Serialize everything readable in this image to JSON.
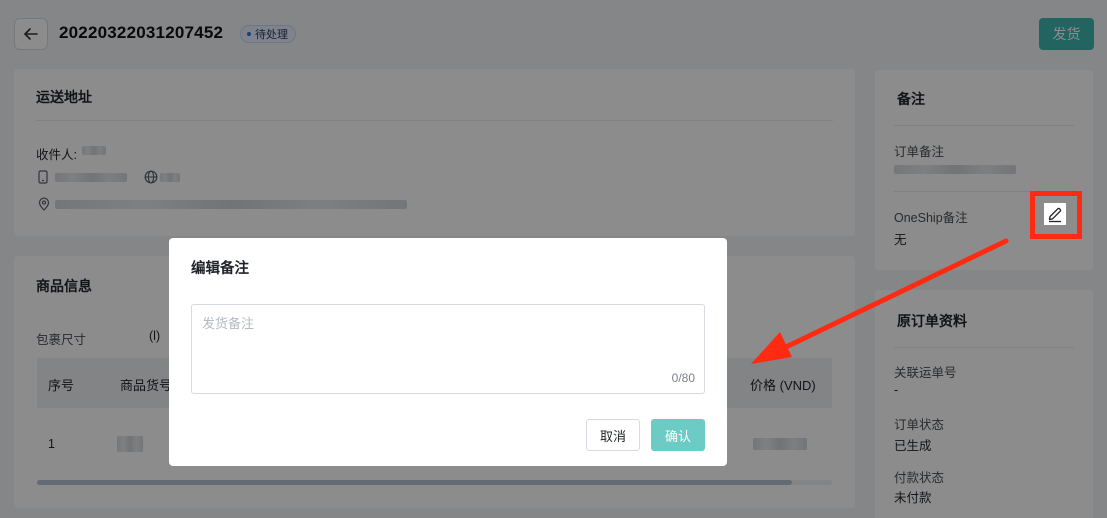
{
  "header": {
    "order_id": "20220322031207452",
    "status": "待处理",
    "ship_button": "发货"
  },
  "shipping_address": {
    "title": "运送地址",
    "recipient_label": "收件人:"
  },
  "product_info": {
    "title": "商品信息",
    "package_size_label": "包裹尺寸",
    "package_size_unit": "(l)",
    "columns": [
      "序号",
      "商品货号",
      "价格 (VND)"
    ],
    "rows": [
      {
        "index": "1"
      }
    ]
  },
  "notes": {
    "title": "备注",
    "order_note_label": "订单备注",
    "oneship_note_label": "OneShip备注",
    "oneship_note_value": "无"
  },
  "original_order": {
    "title": "原订单资料",
    "related_waybill_label": "关联运单号",
    "related_waybill_value": "-",
    "order_status_label": "订单状态",
    "order_status_value": "已生成",
    "payment_status_label": "付款状态",
    "payment_status_value": "未付款"
  },
  "modal": {
    "title": "编辑备注",
    "textarea_placeholder": "发货备注",
    "textarea_value": "",
    "char_count": "0/80",
    "cancel_label": "取消",
    "confirm_label": "确认"
  },
  "icons": {
    "back": "arrow-left-icon",
    "phone": "phone-icon",
    "globe": "globe-icon",
    "location": "location-pin-icon",
    "edit": "pencil-icon",
    "annotation_arrow": "red-arrow-icon"
  },
  "colors": {
    "accent": "#3eb7ad",
    "confirm_disabled": "#6ccbc4",
    "highlight": "#ff2a12",
    "badge_bg": "#e7efff"
  }
}
